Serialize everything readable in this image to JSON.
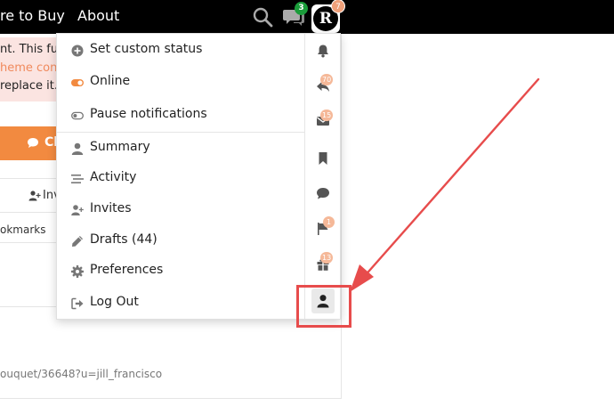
{
  "header": {
    "nav_links": [
      {
        "label": "re to Buy"
      },
      {
        "label": "About"
      }
    ],
    "chat_count": "3",
    "avatar_letter": "R",
    "avatar_badge": "7"
  },
  "background_page": {
    "notice_lines": [
      "nt. This fun",
      "heme con",
      "replace it."
    ],
    "orange_button": "Cl",
    "invites_tab": "Inv",
    "bookmarks_text": "okmarks",
    "url_text": "ouquet/36648?u=jill_francisco"
  },
  "user_menu": {
    "items": [
      {
        "label": "Set custom status",
        "icon": "plus-circle-icon"
      },
      {
        "label": "Online",
        "icon": "toggle-on-icon"
      },
      {
        "label": "Pause notifications",
        "icon": "toggle-off-icon"
      },
      {
        "label": "Summary",
        "icon": "user-icon"
      },
      {
        "label": "Activity",
        "icon": "stream-icon"
      },
      {
        "label": "Invites",
        "icon": "user-plus-icon"
      },
      {
        "label": "Drafts (44)",
        "icon": "pencil-icon"
      },
      {
        "label": "Preferences",
        "icon": "cog-icon"
      },
      {
        "label": "Log Out",
        "icon": "sign-out-icon"
      }
    ],
    "rail": [
      {
        "icon": "bell-icon",
        "badge": ""
      },
      {
        "icon": "replies-icon",
        "badge": "70"
      },
      {
        "icon": "envelope-icon",
        "badge": "15"
      },
      {
        "icon": "bookmark-icon",
        "badge": ""
      },
      {
        "icon": "comment-icon",
        "badge": ""
      },
      {
        "icon": "flag-icon",
        "badge": "1"
      },
      {
        "icon": "gift-icon",
        "badge": "13"
      },
      {
        "icon": "user-icon",
        "badge": ""
      }
    ]
  },
  "colors": {
    "accent": "#f28a40",
    "annotation": "#e74c4c",
    "chat_badge": "#1a9c3a"
  }
}
